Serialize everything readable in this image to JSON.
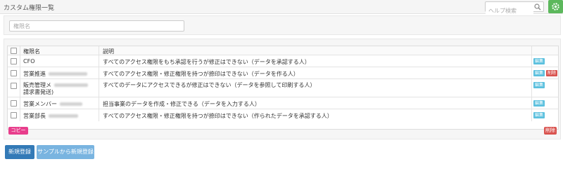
{
  "header": {
    "title": "カスタム権限一覧",
    "help_search_placeholder": "ヘルプ検索",
    "colors": {
      "settings_button": "#5cb85c"
    }
  },
  "filter": {
    "placeholder": "権限名"
  },
  "table": {
    "columns": {
      "name": "権限名",
      "description": "説明"
    },
    "rows": [
      {
        "name": "CFO",
        "name_line2": "",
        "name_masked": false,
        "description": "すべてのアクセス権限をもち承認を行うが修正はできない（データを承認する人）",
        "edit_label": "編集",
        "delete_label": ""
      },
      {
        "name": "営業推進",
        "name_line2": "",
        "name_masked": true,
        "description": "すべてのアクセス権限・修正権限を持つが捺印はできない（データを作る人）",
        "edit_label": "編集",
        "delete_label": "削除"
      },
      {
        "name": "販売管理メ",
        "name_line2": "請求書発送)",
        "name_masked": true,
        "description": "すべてのデータにアクセスできるが修正はできない（データを参照して印刷する人）",
        "edit_label": "編集",
        "delete_label": ""
      },
      {
        "name": "営業メンバー",
        "name_line2": "",
        "name_masked": true,
        "description": "担当事業のデータを作成・修正できる（データを入力する人）",
        "edit_label": "編集",
        "delete_label": ""
      },
      {
        "name": "営業部長",
        "name_line2": "",
        "name_masked": true,
        "description": "すべてのアクセス権限・修正権限を持つが捺印はできない（作られたデータを承認する人）",
        "edit_label": "編集",
        "delete_label": ""
      }
    ]
  },
  "actions": {
    "copy_label": "コピー",
    "delete_label": "削除",
    "new_label": "新規登録",
    "sample_new_label": "サンプルから新規登録"
  }
}
